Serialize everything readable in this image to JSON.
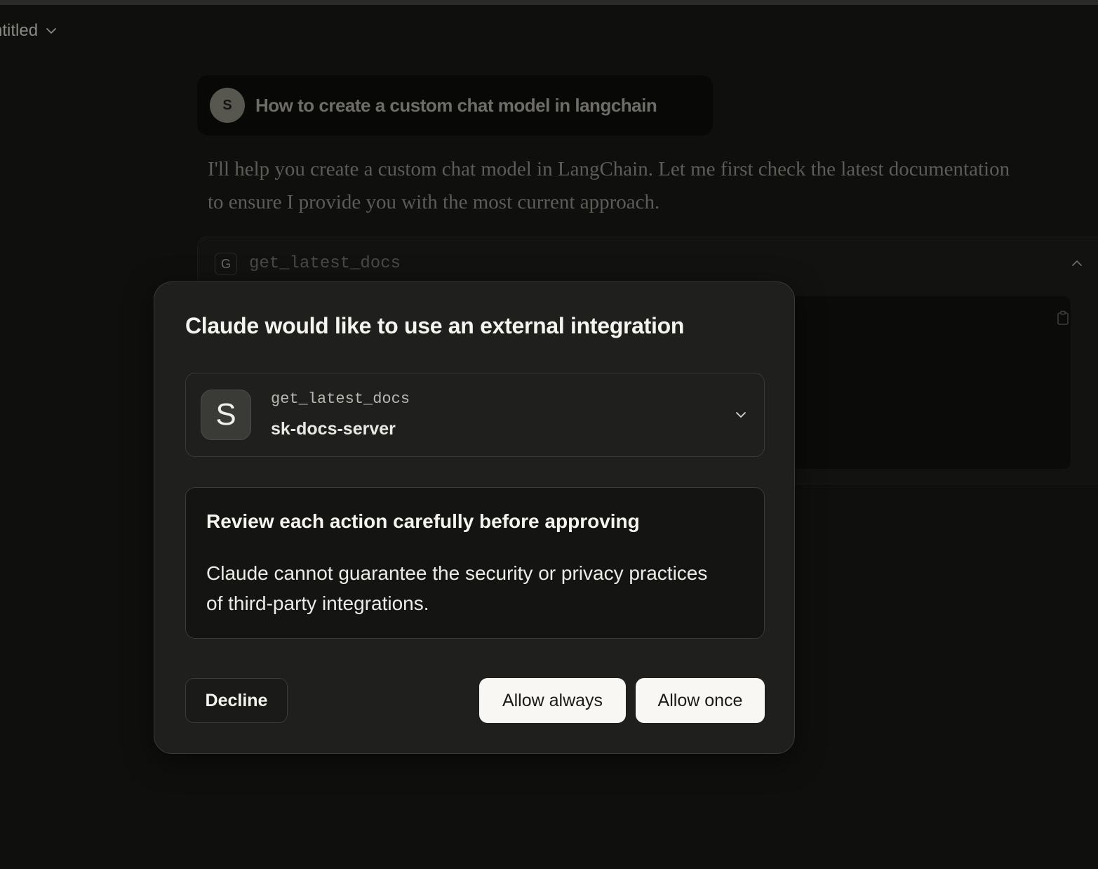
{
  "header": {
    "conversation_title": "ntitled"
  },
  "chat": {
    "user_avatar_letter": "S",
    "user_message": "How to create a custom chat model in langchain",
    "assistant_message": "I'll help you create a custom chat model in LangChain. Let me first check the latest documentation to ensure I provide you with the most current approach.",
    "tool_call": {
      "badge_letter": "G",
      "name": "get_latest_docs"
    }
  },
  "modal": {
    "title": "Claude would like to use an external integration",
    "server": {
      "avatar_letter": "S",
      "tool_name": "get_latest_docs",
      "server_name": "sk-docs-server"
    },
    "warning": {
      "title": "Review each action carefully before approving",
      "body": "Claude cannot guarantee the security or privacy practices of third-party integrations."
    },
    "buttons": {
      "decline": "Decline",
      "allow_always": "Allow always",
      "allow_once": "Allow once"
    }
  },
  "icons": {
    "title_chevron": "chevron-down-icon",
    "tool_chevron": "chevron-up-icon",
    "copy": "clipboard-icon",
    "server_chevron": "chevron-down-icon"
  },
  "colors": {
    "background": "#0f0f0e",
    "modal_background": "#1f1f1e",
    "primary_button": "#f8f7f3",
    "text_primary": "#f5f4ef"
  }
}
